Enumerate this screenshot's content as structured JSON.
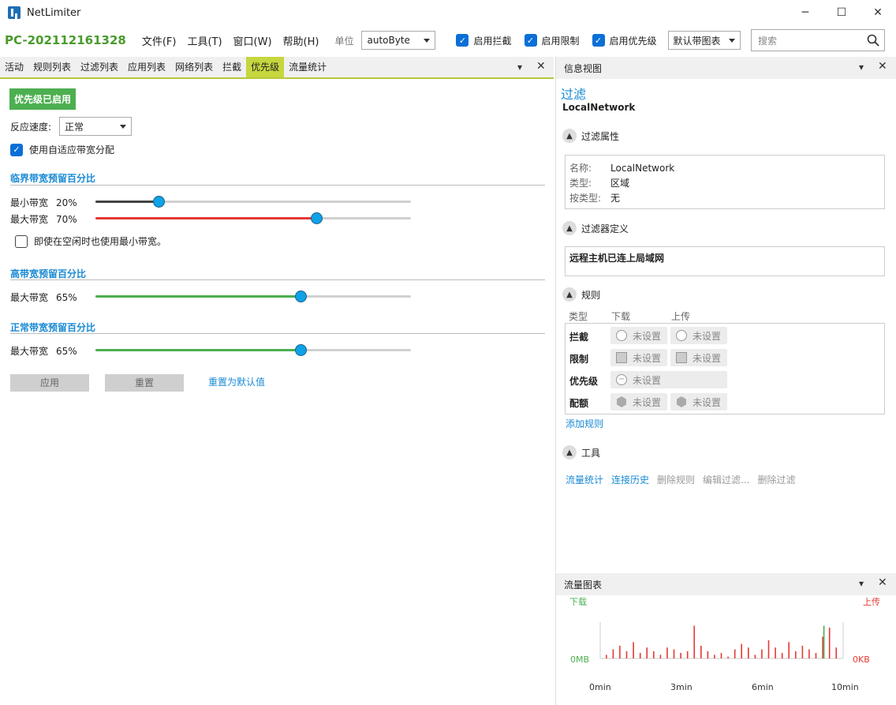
{
  "window": {
    "title": "NetLimiter",
    "minimize": "─",
    "maximize": "☐",
    "close": "✕"
  },
  "menubar": {
    "pc_name": "PC-202112161328",
    "menus": [
      "文件(F)",
      "工具(T)",
      "窗口(W)",
      "帮助(H)"
    ],
    "unit_label": "单位",
    "unit_value": "autoByte",
    "checks": [
      {
        "label": "启用拦截",
        "checked": true
      },
      {
        "label": "启用限制",
        "checked": true
      },
      {
        "label": "启用优先级",
        "checked": true
      }
    ],
    "chart_profile": "默认带图表",
    "search_placeholder": "搜索"
  },
  "left": {
    "tabs": [
      "活动",
      "规则列表",
      "过滤列表",
      "应用列表",
      "网络列表",
      "拦截",
      "优先级",
      "流量统计"
    ],
    "active_tab": "优先级",
    "status_badge": "优先级已启用",
    "reaction_label": "反应速度:",
    "reaction_value": "正常",
    "adaptive_label": "使用自适应带宽分配",
    "critical": {
      "title": "临界带宽预留百分比",
      "min_label": "最小带宽",
      "min_value": "20%",
      "min_fraction": 0.2,
      "max_label": "最大带宽",
      "max_value": "70%",
      "max_fraction": 0.7,
      "idle_label": "即使在空闲时也使用最小带宽。"
    },
    "high": {
      "title": "高带宽预留百分比",
      "max_label": "最大带宽",
      "max_value": "65%",
      "max_fraction": 0.65
    },
    "normal": {
      "title": "正常带宽预留百分比",
      "max_label": "最大带宽",
      "max_value": "65%",
      "max_fraction": 0.65
    },
    "apply_button": "应用",
    "reset_button": "重置",
    "reset_default_link": "重置为默认值"
  },
  "info": {
    "header": "信息视图",
    "filter_heading": "过滤",
    "filter_name": "LocalNetwork",
    "props_title": "过滤属性",
    "props": [
      {
        "label": "名称:",
        "value": "LocalNetwork"
      },
      {
        "label": "类型:",
        "value": "区域"
      },
      {
        "label": "按类型:",
        "value": "无"
      }
    ],
    "def_title": "过滤器定义",
    "def_text": "远程主机已连上局域网",
    "rules_title": "规则",
    "rules_cols": [
      "类型",
      "下载",
      "上传"
    ],
    "rules": [
      {
        "type": "拦截",
        "down": "未设置",
        "up": "未设置"
      },
      {
        "type": "限制",
        "down": "未设置",
        "up": "未设置"
      },
      {
        "type": "优先级",
        "down": "未设置",
        "up": ""
      },
      {
        "type": "配额",
        "down": "未设置",
        "up": "未设置"
      }
    ],
    "add_rule": "添加规则",
    "tools_title": "工具",
    "tools": [
      "流量统计",
      "连接历史",
      "删除规则",
      "编辑过滤...",
      "删除过滤"
    ]
  },
  "traffic": {
    "header": "流量图表",
    "download_label": "下载",
    "upload_label": "上传",
    "down_unit": "0MB",
    "up_unit": "0KB",
    "x_ticks": [
      "0min",
      "3min",
      "6min",
      "10min"
    ],
    "colors": {
      "download": "#4caf50",
      "upload": "#e53935"
    }
  },
  "chart_data": {
    "type": "bar",
    "x_ticks": [
      "0min",
      "3min",
      "6min",
      "10min"
    ],
    "series": [
      {
        "name": "上传",
        "values": [
          0.1,
          0.25,
          0.35,
          0.2,
          0.45,
          0.15,
          0.3,
          0.2,
          0.1,
          0.3,
          0.25,
          0.15,
          0.2,
          0.9,
          0.35,
          0.2,
          0.1,
          0.15,
          0.05,
          0.25,
          0.4,
          0.3,
          0.1,
          0.25,
          0.5,
          0.3,
          0.15,
          0.45,
          0.2,
          0.35,
          0.25,
          0.15,
          0.6,
          0.85,
          0.3
        ]
      },
      {
        "name": "下载",
        "values": [
          0,
          0,
          0,
          0,
          0,
          0,
          0,
          0,
          0,
          0,
          0,
          0,
          0,
          0,
          0,
          0,
          0,
          0,
          0,
          0,
          0,
          0,
          0,
          0,
          0,
          0,
          0,
          0,
          0,
          0,
          0,
          0,
          0.9,
          0,
          0
        ]
      }
    ]
  }
}
